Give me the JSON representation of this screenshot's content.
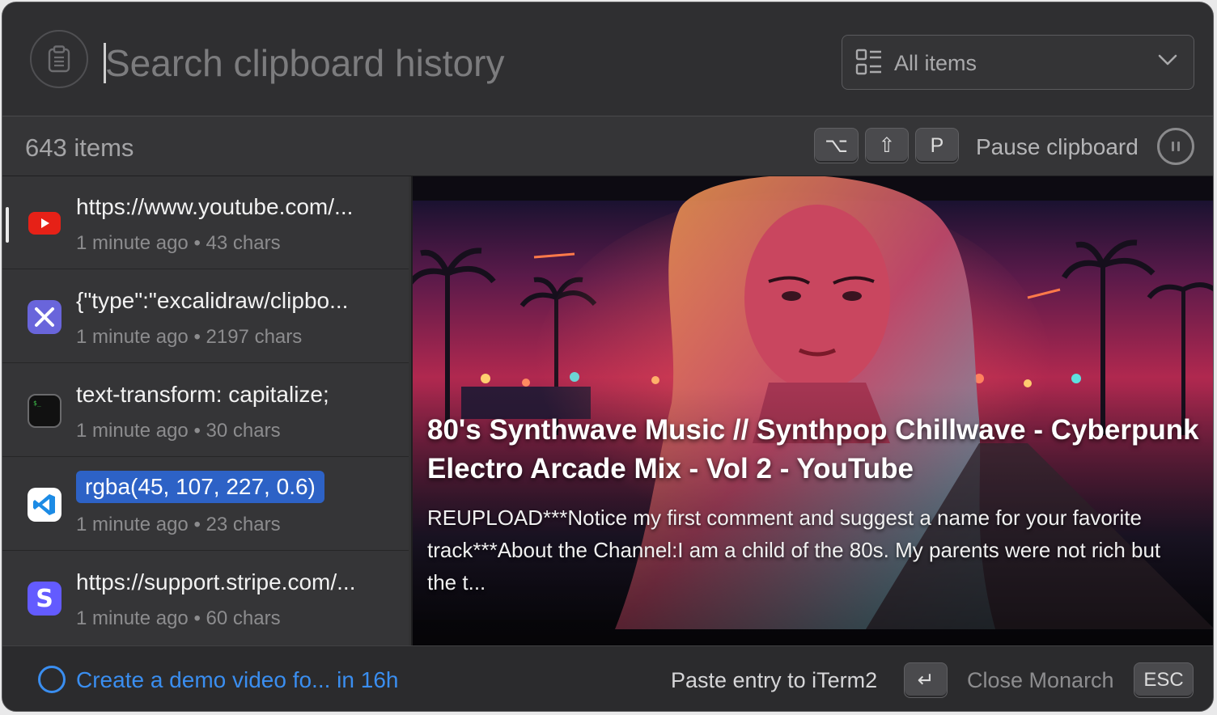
{
  "search": {
    "placeholder": "Search clipboard history",
    "filter_label": "All items"
  },
  "status": {
    "item_count": "643 items",
    "shortcut_keys": [
      "⌥",
      "⇧",
      "P"
    ],
    "pause_label": "Pause clipboard"
  },
  "list": {
    "items": [
      {
        "app": "youtube-icon",
        "title": "https://www.youtube.com/...",
        "time": "1 minute ago",
        "chars": "43 chars",
        "selected": true
      },
      {
        "app": "excalidraw-icon",
        "title": "{\"type\":\"excalidraw/clipbo...",
        "time": "1 minute ago",
        "chars": "2197 chars"
      },
      {
        "app": "terminal-icon",
        "title": "text-transform: capitalize;",
        "time": "1 minute ago",
        "chars": "30 chars"
      },
      {
        "app": "vscode-icon",
        "title": "rgba(45, 107, 227, 0.6)",
        "time": "1 minute ago",
        "chars": "23 chars",
        "color_swatch": "#2d6be3"
      },
      {
        "app": "stripe-icon",
        "title": "https://support.stripe.com/...",
        "time": "1 minute ago",
        "chars": "60 chars"
      }
    ],
    "separator": "•"
  },
  "preview": {
    "title": "80's Synthwave Music // Synthpop Chillwave - Cyberpunk Electro Arcade Mix - Vol 2 - YouTube",
    "description": "REUPLOAD***Notice my first comment and suggest a name for your favorite track***About the Channel:I am a child of the 80s. My parents were not rich but the t..."
  },
  "footer": {
    "reminder": "Create a demo video fo... in 16h",
    "paste_label": "Paste entry to iTerm2",
    "return_key": "↵",
    "close_label": "Close Monarch",
    "esc_key": "ESC"
  },
  "colors": {
    "accent": "#3a8ef0",
    "highlight": "#2d62c6",
    "background": "#323233"
  }
}
